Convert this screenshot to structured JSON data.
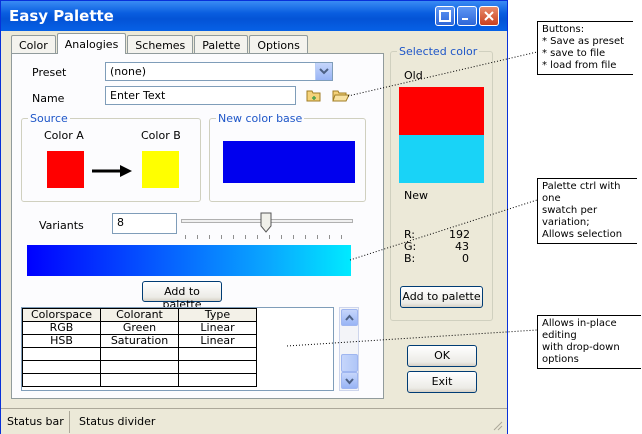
{
  "window": {
    "title": "Easy Palette"
  },
  "tabs": [
    "Color",
    "Analogies",
    "Schemes",
    "Palette",
    "Options"
  ],
  "preset": {
    "label": "Preset",
    "value": "(none)"
  },
  "name": {
    "label": "Name",
    "placeholder": "Enter Text",
    "value": "Enter Text"
  },
  "source": {
    "title": "Source",
    "color_a_label": "Color A",
    "color_b_label": "Color B",
    "color_a": "#ff0000",
    "color_b": "#ffff00"
  },
  "new_color_base": {
    "title": "New color base",
    "color": "#0000ee"
  },
  "variants": {
    "label": "Variants",
    "value": "8"
  },
  "add_to_palette": "Add to palette",
  "table": {
    "headers": [
      "Colorspace",
      "Colorant",
      "Type"
    ],
    "rows": [
      [
        "RGB",
        "Green",
        "Linear"
      ],
      [
        "HSB",
        "Saturation",
        "Linear"
      ],
      [
        "",
        "",
        ""
      ],
      [
        "",
        "",
        ""
      ],
      [
        "",
        "",
        ""
      ]
    ]
  },
  "selected_color": {
    "title": "Selected color",
    "old_label": "Old",
    "new_label": "New",
    "old_color": "#ff0000",
    "new_color": "#19d3f7",
    "r_label": "R:",
    "r_value": "192",
    "g_label": "G:",
    "g_value": "43",
    "b_label": "B:",
    "b_value": "0",
    "add_button": "Add to palette"
  },
  "buttons": {
    "ok": "OK",
    "exit": "Exit"
  },
  "status": {
    "left": "Status bar",
    "right": "Status divider"
  },
  "annotations": {
    "buttons_note": [
      "Buttons:",
      "* Save as preset",
      "* save to file",
      "* load from file"
    ],
    "palette_note": [
      "Palette ctrl with one",
      "swatch per variation;",
      "Allows selection"
    ],
    "grid_note": [
      "Allows in-place editing",
      "with drop-down options"
    ]
  }
}
